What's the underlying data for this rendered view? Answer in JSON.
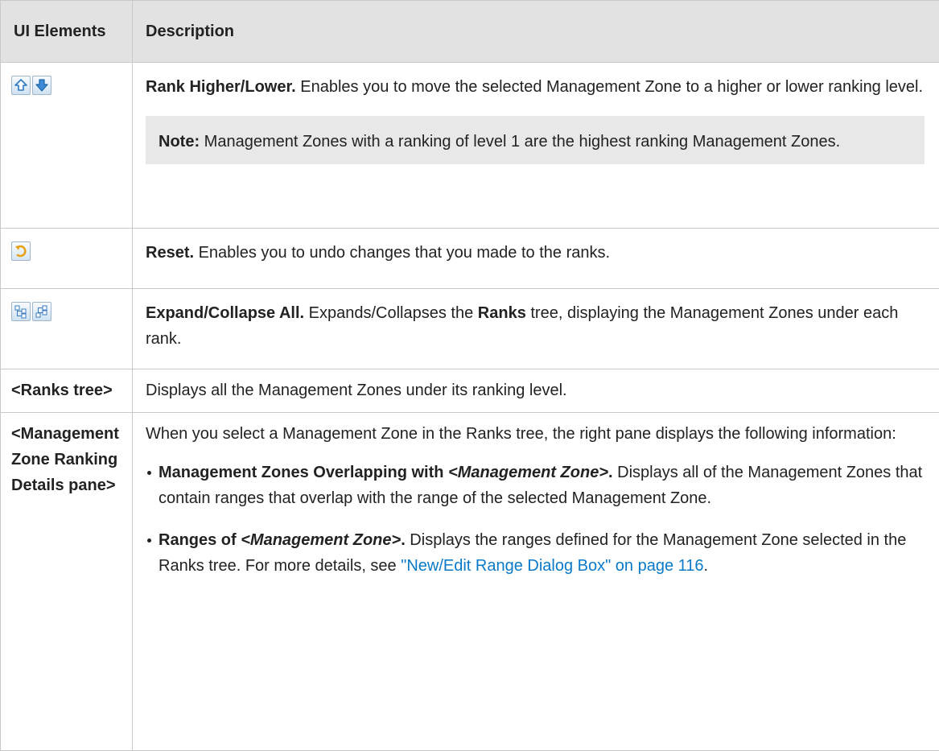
{
  "table": {
    "header": {
      "col1": "UI Elements",
      "col2": "Description"
    },
    "rows": {
      "rank": {
        "title": "Rank Higher/Lower.",
        "text": " Enables you to move the selected Management Zone to a higher or lower ranking level.",
        "note_label": "Note:",
        "note_text": " Management Zones with a ranking of level 1 are the highest ranking Management Zones.",
        "icons": [
          "arrow-up-icon",
          "arrow-down-icon"
        ]
      },
      "reset": {
        "title": "Reset.",
        "text": " Enables you to undo changes that you made to the ranks.",
        "icons": [
          "undo-icon"
        ]
      },
      "expand": {
        "title": "Expand/Collapse All.",
        "text1": " Expands/Collapses the ",
        "ranks": "Ranks",
        "text2": " tree, displaying the Management Zones under each rank.",
        "icons": [
          "expand-all-icon",
          "collapse-all-icon"
        ]
      },
      "ranks_tree": {
        "element": "<Ranks tree>",
        "text": "Displays all the Management Zones under its ranking level."
      },
      "details": {
        "element": "<Management Zone Ranking Details pane>",
        "intro": "When you select a Management Zone in the Ranks tree, the right pane displays the following information:",
        "b1_bold": "Management Zones Overlapping with ",
        "b1_italic": "<Management Zone>",
        "b1_dot": ".",
        "b1_text": " Displays all of the Management Zones that contain ranges that overlap with the range of the selected Management Zone.",
        "b2_bold": "Ranges of ",
        "b2_italic": "<Management Zone>",
        "b2_dot": ".",
        "b2_text": " Displays the ranges defined for the Management Zone selected in the Ranks tree. For more details, see ",
        "b2_link": "\"New/Edit Range Dialog Box\" on page 116",
        "b2_end": "."
      }
    }
  },
  "colors": {
    "header_bg": "#e2e2e2",
    "note_bg": "#e8e8e8",
    "link": "#0a7ac8",
    "border": "#c9c9c9"
  }
}
